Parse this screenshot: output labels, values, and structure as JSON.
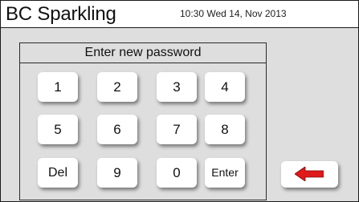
{
  "header": {
    "title": "BC Sparkling",
    "datetime": "10:30 Wed 14, Nov 2013"
  },
  "keypad": {
    "prompt": "Enter new password",
    "keys": [
      "1",
      "2",
      "3",
      "4",
      "5",
      "6",
      "7",
      "8",
      "Del",
      "9",
      "0",
      "Enter"
    ]
  },
  "back_button": {
    "icon": "left-arrow-icon",
    "color": "#e0191b"
  }
}
